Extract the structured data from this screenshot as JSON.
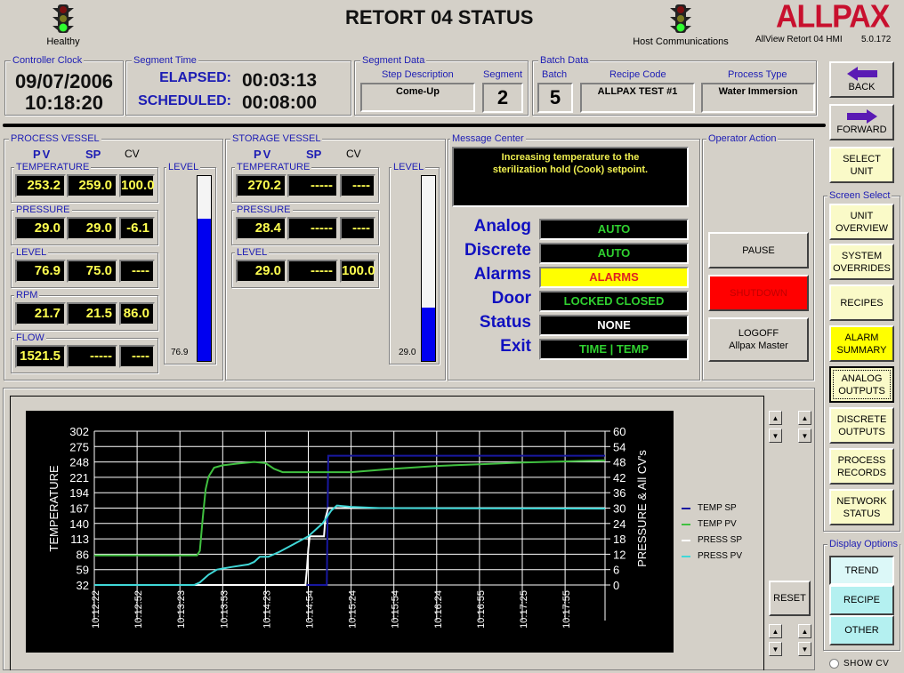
{
  "header": {
    "title": "RETORT 04 STATUS",
    "health_label": "Healthy",
    "host_comm_label": "Host Communications",
    "brand": "ALLPAX",
    "app_name": "AllView Retort 04 HMI",
    "version": "5.0.172"
  },
  "controller_clock": {
    "title": "Controller Clock",
    "date": "09/07/2006",
    "time": "10:18:20"
  },
  "segment_time": {
    "title": "Segment Time",
    "elapsed_label": "ELAPSED:",
    "elapsed": "00:03:13",
    "scheduled_label": "SCHEDULED:",
    "scheduled": "00:08:00"
  },
  "segment_data": {
    "title": "Segment Data",
    "step_label": "Step Description",
    "step": "Come-Up",
    "segment_label": "Segment",
    "segment": "2"
  },
  "batch_data": {
    "title": "Batch Data",
    "batch_label": "Batch",
    "batch": "5",
    "recipe_label": "Recipe Code",
    "recipe": "ALLPAX TEST #1",
    "process_label": "Process Type",
    "process": "Water Immersion"
  },
  "nav": {
    "back": "BACK",
    "forward": "FORWARD",
    "select_unit": [
      "SELECT",
      "UNIT"
    ]
  },
  "screen_select": {
    "title": "Screen Select",
    "items": [
      {
        "l1": "UNIT",
        "l2": "OVERVIEW"
      },
      {
        "l1": "SYSTEM",
        "l2": "OVERRIDES"
      },
      {
        "l1": "RECIPES",
        "l2": ""
      },
      {
        "l1": "ALARM",
        "l2": "SUMMARY"
      },
      {
        "l1": "ANALOG",
        "l2": "OUTPUTS"
      },
      {
        "l1": "DISCRETE",
        "l2": "OUTPUTS"
      },
      {
        "l1": "PROCESS",
        "l2": "RECORDS"
      },
      {
        "l1": "NETWORK",
        "l2": "STATUS"
      }
    ]
  },
  "display_options": {
    "title": "Display Options",
    "items": [
      "TREND",
      "RECIPE",
      "OTHER"
    ],
    "show_cv_label": "SHOW CV"
  },
  "process_vessel": {
    "title": "PROCESS VESSEL",
    "col_pv": "PV",
    "col_sp": "SP",
    "col_cv": "CV",
    "rows": [
      {
        "label": "TEMPERATURE",
        "pv": "253.2",
        "sp": "259.0",
        "cv": "100.0"
      },
      {
        "label": "PRESSURE",
        "pv": "29.0",
        "sp": "29.0",
        "cv": "-6.1"
      },
      {
        "label": "LEVEL",
        "pv": "76.9",
        "sp": "75.0",
        "cv": "----"
      },
      {
        "label": "RPM",
        "pv": "21.7",
        "sp": "21.5",
        "cv": "86.0"
      },
      {
        "label": "FLOW",
        "pv": "1521.5",
        "sp": "-----",
        "cv": "----"
      }
    ],
    "level_title": "LEVEL",
    "level_value": "76.9",
    "level_fraction": 0.769
  },
  "storage_vessel": {
    "title": "STORAGE VESSEL",
    "col_pv": "PV",
    "col_sp": "SP",
    "col_cv": "CV",
    "rows": [
      {
        "label": "TEMPERATURE",
        "pv": "270.2",
        "sp": "-----",
        "cv": "----"
      },
      {
        "label": "PRESSURE",
        "pv": "28.4",
        "sp": "-----",
        "cv": "----"
      },
      {
        "label": "LEVEL",
        "pv": "29.0",
        "sp": "-----",
        "cv": "100.0"
      }
    ],
    "level_title": "LEVEL",
    "level_value": "29.0",
    "level_fraction": 0.29
  },
  "message_center": {
    "title": "Message Center",
    "message": "Increasing temperature to the sterilization hold (Cook) setpoint.",
    "statuses": [
      {
        "label": "Analog",
        "value": "AUTO",
        "color": "#30d030",
        "bg": "#000000"
      },
      {
        "label": "Discrete",
        "value": "AUTO",
        "color": "#30d030",
        "bg": "#000000"
      },
      {
        "label": "Alarms",
        "value": "ALARMS",
        "color": "#e02020",
        "bg": "#ffff00"
      },
      {
        "label": "Door",
        "value": "LOCKED CLOSED",
        "color": "#30d030",
        "bg": "#000000"
      },
      {
        "label": "Status",
        "value": "NONE",
        "color": "#ffffff",
        "bg": "#000000"
      },
      {
        "label": "Exit",
        "value": "TIME | TEMP",
        "color": "#30d030",
        "bg": "#000000"
      }
    ]
  },
  "operator_action": {
    "title": "Operator Action",
    "pause": "PAUSE",
    "shutdown": "SHUTDOWN",
    "logoff": "LOGOFF",
    "logoff_user": "Allpax Master"
  },
  "trend": {
    "reset_label": "RESET"
  },
  "chart_data": {
    "type": "line",
    "title": "",
    "xlabel": "",
    "ylabel": "TEMPERATURE",
    "y2label": "PRESSURE & All CV's",
    "ylim": [
      32,
      302
    ],
    "y2lim": [
      0,
      60
    ],
    "yticks": [
      32,
      59,
      86,
      113,
      140,
      167,
      194,
      221,
      248,
      275,
      302
    ],
    "y2ticks": [
      0,
      6,
      12,
      18,
      24,
      30,
      36,
      42,
      48,
      54,
      60
    ],
    "x_unit": "seconds since 10:12:22",
    "xlim": [
      0,
      358
    ],
    "xticks": [
      {
        "t": 0,
        "label": "10:12:22"
      },
      {
        "t": 30,
        "label": "10:12:52"
      },
      {
        "t": 60,
        "label": "10:13:23"
      },
      {
        "t": 90,
        "label": "10:13:53"
      },
      {
        "t": 120,
        "label": "10:14:23"
      },
      {
        "t": 150,
        "label": "10:14:54"
      },
      {
        "t": 180,
        "label": "10:15:24"
      },
      {
        "t": 210,
        "label": "10:15:54"
      },
      {
        "t": 240,
        "label": "10:16:24"
      },
      {
        "t": 270,
        "label": "10:16:55"
      },
      {
        "t": 300,
        "label": "10:17:25"
      },
      {
        "t": 330,
        "label": "10:17:55"
      }
    ],
    "grid": true,
    "legend_position": "right",
    "series": [
      {
        "name": "TEMP SP",
        "axis": "left",
        "color": "#1818a0",
        "points": [
          [
            0,
            32
          ],
          [
            163,
            32
          ],
          [
            164,
            259
          ],
          [
            358,
            259
          ]
        ]
      },
      {
        "name": "TEMP PV",
        "axis": "left",
        "color": "#40c040",
        "points": [
          [
            0,
            84
          ],
          [
            72,
            84
          ],
          [
            74,
            92
          ],
          [
            76,
            150
          ],
          [
            78,
            200
          ],
          [
            80,
            222
          ],
          [
            84,
            238
          ],
          [
            90,
            242
          ],
          [
            100,
            245
          ],
          [
            112,
            248
          ],
          [
            120,
            246
          ],
          [
            126,
            236
          ],
          [
            132,
            230
          ],
          [
            150,
            230
          ],
          [
            180,
            230
          ],
          [
            210,
            236
          ],
          [
            240,
            241
          ],
          [
            270,
            244
          ],
          [
            300,
            247
          ],
          [
            330,
            249
          ],
          [
            358,
            251
          ]
        ]
      },
      {
        "name": "PRESS SP",
        "axis": "right",
        "color": "#ffffff",
        "points": [
          [
            0,
            0
          ],
          [
            148,
            0
          ],
          [
            149,
            6
          ],
          [
            150,
            14
          ],
          [
            151,
            19
          ],
          [
            161,
            19
          ],
          [
            162,
            26
          ],
          [
            164,
            30
          ],
          [
            358,
            30
          ]
        ]
      },
      {
        "name": "PRESS PV",
        "axis": "right",
        "color": "#40d8d8",
        "points": [
          [
            0,
            0
          ],
          [
            70,
            0
          ],
          [
            74,
            1
          ],
          [
            80,
            4
          ],
          [
            86,
            6
          ],
          [
            96,
            7
          ],
          [
            108,
            8
          ],
          [
            112,
            9
          ],
          [
            116,
            11
          ],
          [
            122,
            11
          ],
          [
            130,
            13
          ],
          [
            140,
            16
          ],
          [
            150,
            19
          ],
          [
            160,
            24
          ],
          [
            166,
            29
          ],
          [
            170,
            31
          ],
          [
            180,
            30.5
          ],
          [
            200,
            30
          ],
          [
            358,
            29.8
          ]
        ]
      }
    ]
  }
}
